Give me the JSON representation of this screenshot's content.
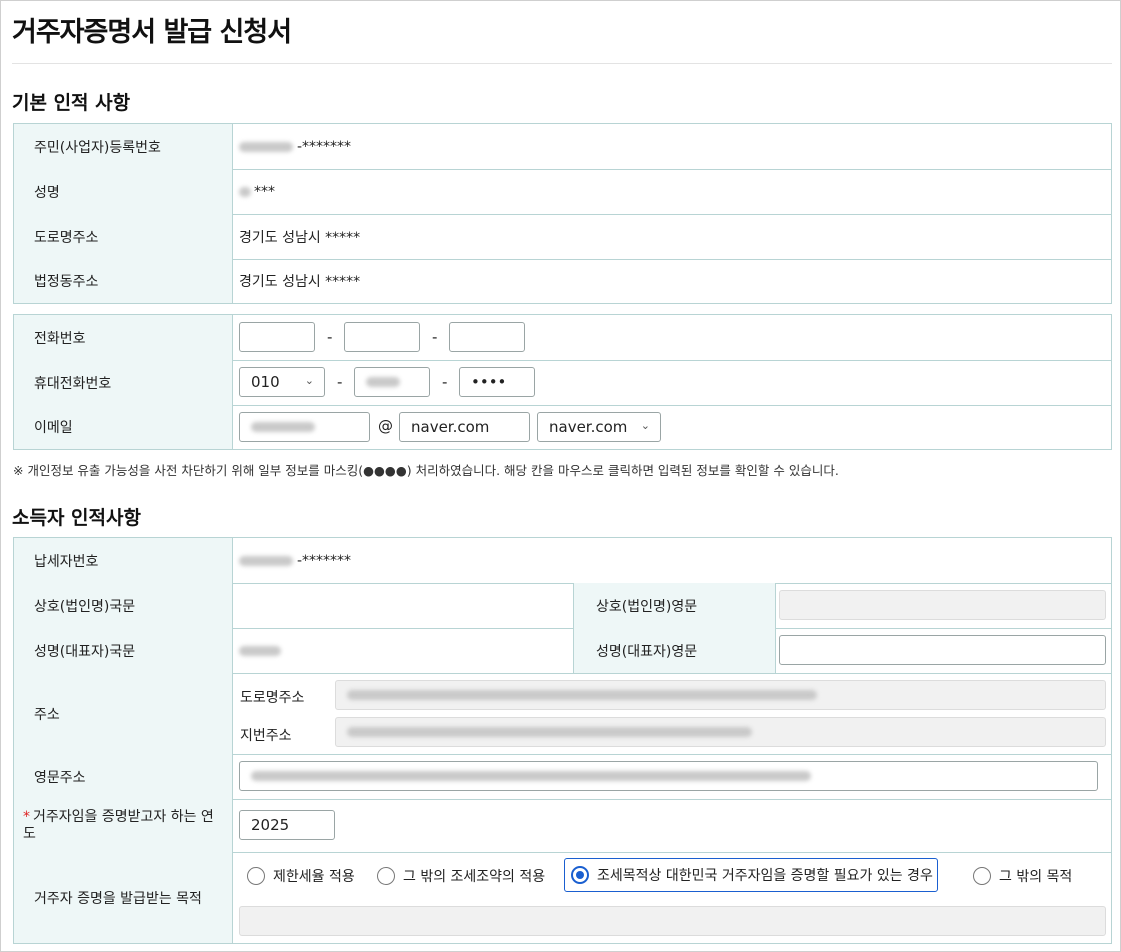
{
  "page_title": "거주자증명서 발급 신청서",
  "section_basic": {
    "title": "기본 인적 사항",
    "rrn_label": "주민(사업자)등록번호",
    "rrn_value": "-*******",
    "name_label": "성명",
    "name_value": "***",
    "road_addr_label": "도로명주소",
    "road_addr_value": "경기도 성남시 *****",
    "lot_addr_label": "법정동주소",
    "lot_addr_value": "경기도 성남시 *****"
  },
  "contact": {
    "phone_label": "전화번호",
    "mobile_label": "휴대전화번호",
    "mobile_prefix": "010",
    "mobile_last": "••••",
    "email_label": "이메일",
    "email_at": "@",
    "email_domain": "naver.com",
    "email_domain_select": "naver.com",
    "dash": "-"
  },
  "notice": "※ 개인정보 유출 가능성을 사전 차단하기 위해 일부 정보를 마스킹(●●●●) 처리하였습니다. 해당 칸을 마우스로 클릭하면 입력된 정보를 확인할 수 있습니다.",
  "section_income": {
    "title": "소득자 인적사항",
    "tin_label": "납세자번호",
    "tin_value": "-*******",
    "company_kr_label": "상호(법인명)국문",
    "company_en_label": "상호(법인명)영문",
    "rep_kr_label": "성명(대표자)국문",
    "rep_en_label": "성명(대표자)영문",
    "address_label": "주소",
    "road_addr_label": "도로명주소",
    "lot_addr_label": "지번주소",
    "en_addr_label": "영문주소",
    "year_required_mark": "*",
    "year_label": "거주자임을 증명받고자 하는 연도",
    "year_value": "2025",
    "purpose_label": "거주자 증명을 발급받는 목적",
    "purpose_options": [
      "제한세율 적용",
      "그 밖의 조세조약의 적용",
      "조세목적상 대한민국 거주자임을 증명할 필요가 있는 경우",
      "그 밖의 목적"
    ]
  }
}
